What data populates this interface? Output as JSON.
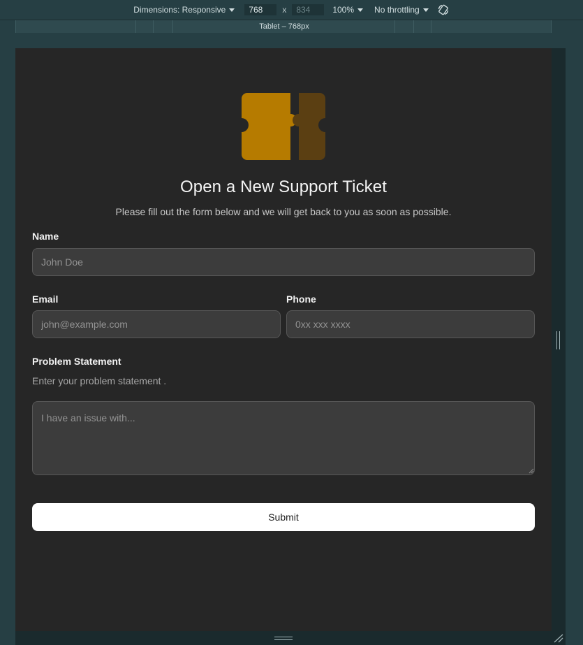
{
  "devtools": {
    "dimensions_label": "Dimensions: Responsive",
    "width": "768",
    "times": "x",
    "height": "834",
    "zoom": "100%",
    "throttling": "No throttling",
    "preset_label": "Tablet – 768px"
  },
  "page": {
    "title": "Open a New Support Ticket",
    "subtitle": "Please fill out the form below and we will get back to you as soon as possible.",
    "logo_colors": {
      "left": "#b67b00",
      "right": "#5b3f12"
    }
  },
  "form": {
    "name_label": "Name",
    "name_placeholder": "John Doe",
    "email_label": "Email",
    "email_placeholder": "john@example.com",
    "phone_label": "Phone",
    "phone_placeholder": "0xx xxx xxxx",
    "problem_label": "Problem Statement",
    "problem_helper": "Enter your problem statement .",
    "problem_placeholder": "I have an issue with...",
    "submit_label": "Submit"
  }
}
